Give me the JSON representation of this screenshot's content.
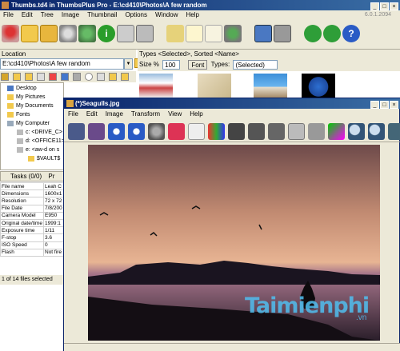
{
  "main_window": {
    "title": "Thumbs.td4 in ThumbsPlus Pro - E:\\cd410\\Photos\\A few random",
    "menu": [
      "File",
      "Edit",
      "Tree",
      "Image",
      "Thumbnail",
      "Options",
      "Window",
      "Help"
    ],
    "version": "6.0.1.2094"
  },
  "location": {
    "label": "Location",
    "path": "E:\\cd410\\Photos\\A few random"
  },
  "tree": {
    "items": [
      "Desktop",
      "My Pictures",
      "My Documents",
      "Fonts",
      "My Computer",
      "c: <DRIVE_C>",
      "d: <OFFICE11>",
      "e: <aw-d on s",
      "$VAULT$"
    ]
  },
  "tasks_tab": {
    "label": "Tasks (0/0)",
    "label2": "Pr"
  },
  "properties": {
    "rows": [
      {
        "k": "File name",
        "v": "Leah C"
      },
      {
        "k": "Dimensions",
        "v": "1600x1"
      },
      {
        "k": "Resolution",
        "v": "72 x 72"
      },
      {
        "k": "File Date",
        "v": "7/8/200"
      },
      {
        "k": "Camera Model",
        "v": "E950"
      },
      {
        "k": "Original date/time",
        "v": "1999:1"
      },
      {
        "k": "Exposure time",
        "v": "1/11"
      },
      {
        "k": "F-stop",
        "v": "3.6"
      },
      {
        "k": "ISO Speed",
        "v": "0"
      },
      {
        "k": "Flash",
        "v": "Not fire"
      }
    ]
  },
  "status_main": "1 of 14 files selected",
  "types_sorted": "Types <Selected>, Sorted <Name>",
  "size_bar": {
    "label": "Size %",
    "value": "100",
    "font": "Font",
    "types_label": "Types:",
    "types_value": "(Selected)"
  },
  "viewer": {
    "title": "(*)Seagulls.jpg",
    "menu": [
      "File",
      "Edit",
      "Image",
      "Transform",
      "View",
      "Help"
    ]
  },
  "watermark": {
    "text": "Taimienphi",
    "sub": ".vn"
  },
  "colors": {
    "title_start": "#0a246a",
    "title_end": "#3a6ea5",
    "chrome": "#ece9d8"
  }
}
